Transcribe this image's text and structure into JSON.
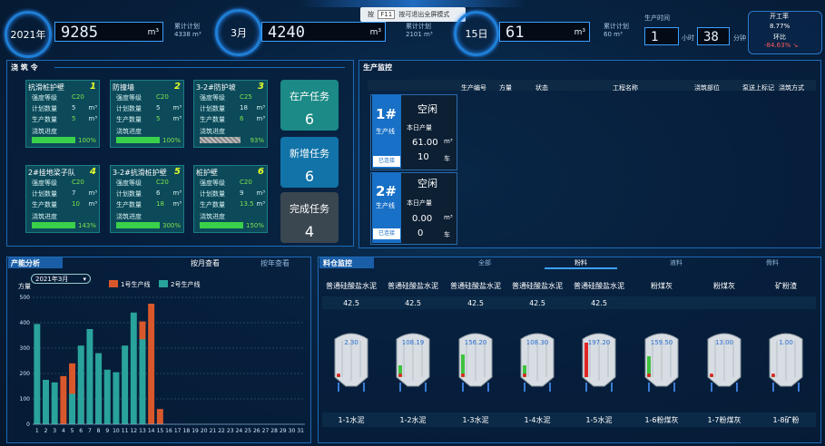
{
  "header": {
    "mode_key": "F11",
    "mode_label": "按可退出全屏模式",
    "mode_prefix": "按"
  },
  "stats": {
    "year": {
      "label": "2021年",
      "value": "9285",
      "unit": "m³",
      "plan_label": "累计计划",
      "plan_value": "4338 m³"
    },
    "month": {
      "label": "3月",
      "value": "4240",
      "unit": "m³",
      "plan_label": "累计计划",
      "plan_value": "2101 m³"
    },
    "day": {
      "label": "15日",
      "value": "61",
      "unit": "m³",
      "plan_label": "累计计划",
      "plan_value": "60 m³"
    },
    "production_time": {
      "label": "生产时间",
      "hours": "1",
      "hours_unit": "小时",
      "minutes": "38",
      "minutes_unit": "分钟"
    },
    "operation_rate": {
      "label": "开工率",
      "value": "8.77%",
      "compare_label": "环比",
      "compare_value": "-84.63% ↘"
    }
  },
  "pour_orders": {
    "title": "浇 筑 令",
    "cards": [
      {
        "name": "抗滑桩护壁",
        "num": "1",
        "grade_label": "强度等级",
        "grade": "C20",
        "plan_label": "计划数量",
        "plan": "5",
        "plan_unit": "m³",
        "prod_label": "生产数量",
        "prod": "5",
        "prod_unit": "m³",
        "progress_label": "浇筑进度",
        "progress": "100%",
        "progress_value": 1.0
      },
      {
        "name": "防撞墙",
        "num": "2",
        "grade_label": "强度等级",
        "grade": "C20",
        "plan_label": "计划数量",
        "plan": "5",
        "plan_unit": "m³",
        "prod_label": "生产数量",
        "prod": "5",
        "prod_unit": "m³",
        "progress_label": "浇筑进度",
        "progress": "100%",
        "progress_value": 1.0
      },
      {
        "name": "3-2#防护坡",
        "num": "3",
        "grade_label": "强度等级",
        "grade": "C25",
        "plan_label": "计划数量",
        "plan": "18",
        "plan_unit": "m³",
        "prod_label": "生产数量",
        "prod": "6",
        "prod_unit": "m³",
        "progress_label": "浇筑进度",
        "progress": "93%",
        "progress_value": 0.93
      },
      {
        "name": "2#挂地梁子队",
        "num": "4",
        "grade_label": "强度等级",
        "grade": "C20",
        "plan_label": "计划数量",
        "plan": "7",
        "plan_unit": "m³",
        "prod_label": "生产数量",
        "prod": "10",
        "prod_unit": "m³",
        "progress_label": "浇筑进度",
        "progress": "143%",
        "progress_value": 1.0
      },
      {
        "name": "3-2#抗滑桩护壁",
        "num": "5",
        "grade_label": "强度等级",
        "grade": "C20",
        "plan_label": "计划数量",
        "plan": "6",
        "plan_unit": "m³",
        "prod_label": "生产数量",
        "prod": "18",
        "prod_unit": "m³",
        "progress_label": "浇筑进度",
        "progress": "300%",
        "progress_value": 1.0
      },
      {
        "name": "桩护壁",
        "num": "6",
        "grade_label": "强度等级",
        "grade": "C20",
        "plan_label": "计划数量",
        "plan": "9",
        "plan_unit": "m³",
        "prod_label": "生产数量",
        "prod": "13.5",
        "prod_unit": "m³",
        "progress_label": "浇筑进度",
        "progress": "150%",
        "progress_value": 1.0
      }
    ],
    "tasks": [
      {
        "label": "在产任务",
        "value": "6"
      },
      {
        "label": "新增任务",
        "value": "6"
      },
      {
        "label": "完成任务",
        "value": "4"
      }
    ]
  },
  "production_monitor": {
    "title": "生产监控",
    "columns": [
      "生产编号",
      "方量",
      "状态",
      "工程名称",
      "浇筑部位",
      "泵送上标记",
      "浇筑方式"
    ],
    "lines": [
      {
        "id": "1#",
        "line_label": "生产线",
        "status": "空闲",
        "connected": "已连接",
        "today_label": "本日产量",
        "volume": "61.00",
        "volume_unit": "m³",
        "trucks": "10",
        "trucks_unit": "车"
      },
      {
        "id": "2#",
        "line_label": "生产线",
        "status": "空闲",
        "connected": "已连接",
        "today_label": "本日产量",
        "volume": "0.00",
        "volume_unit": "m³",
        "trucks": "0",
        "trucks_unit": "车"
      }
    ]
  },
  "output_analysis": {
    "title": "产能分析",
    "tabs": [
      "按月查看",
      "按年查看"
    ],
    "month_select": "2021年3月",
    "chart_data": {
      "type": "bar",
      "ylabel": "方量",
      "ylim": [
        0,
        500
      ],
      "yticks": [
        0,
        100,
        200,
        300,
        400,
        500
      ],
      "categories": [
        "1",
        "2",
        "3",
        "4",
        "5",
        "6",
        "7",
        "8",
        "9",
        "10",
        "11",
        "12",
        "13",
        "14",
        "15",
        "16",
        "17",
        "18",
        "19",
        "20",
        "21",
        "22",
        "23",
        "24",
        "25",
        "26",
        "27",
        "28",
        "29",
        "30",
        "31"
      ],
      "series": [
        {
          "name": "1号生产线",
          "color": "#d9582b",
          "values": [
            10,
            0,
            0,
            190,
            240,
            145,
            0,
            100,
            0,
            0,
            0,
            0,
            405,
            475,
            60,
            0,
            0,
            0,
            0,
            0,
            0,
            0,
            0,
            0,
            0,
            0,
            0,
            0,
            0,
            0,
            0
          ]
        },
        {
          "name": "2号生产线",
          "color": "#29a39c",
          "values": [
            395,
            175,
            165,
            0,
            120,
            310,
            375,
            280,
            215,
            205,
            310,
            440,
            335,
            0,
            0,
            0,
            0,
            0,
            0,
            0,
            0,
            0,
            0,
            0,
            0,
            0,
            0,
            0,
            0,
            0,
            0
          ]
        }
      ]
    }
  },
  "material_monitor": {
    "title": "料仓监控",
    "tabs": [
      "全部",
      "粉料",
      "液料",
      "骨料"
    ],
    "tanks": [
      {
        "name": "普通硅酸盐水泥",
        "grade": "42.5",
        "value": "2.30",
        "fill": 0.02,
        "bin": "1-1水泥"
      },
      {
        "name": "普通硅酸盐水泥",
        "grade": "42.5",
        "value": "108.19",
        "fill": 0.3,
        "bin": "1-2水泥"
      },
      {
        "name": "普通硅酸盐水泥",
        "grade": "42.5",
        "value": "156.20",
        "fill": 0.6,
        "bin": "1-3水泥"
      },
      {
        "name": "普通硅酸盐水泥",
        "grade": "42.5",
        "value": "108.30",
        "fill": 0.3,
        "bin": "1-4水泥"
      },
      {
        "name": "普通硅酸盐水泥",
        "grade": "42.5",
        "value": "197.20",
        "fill": 0.9,
        "bin": "1-5水泥",
        "red": true
      },
      {
        "name": "粉煤灰",
        "grade": "",
        "value": "159.50",
        "fill": 0.55,
        "bin": "1-6粉煤灰"
      },
      {
        "name": "粉煤灰",
        "grade": "",
        "value": "13.00",
        "fill": 0.05,
        "bin": "1-7粉煤灰"
      },
      {
        "name": "矿粉渣",
        "grade": "",
        "value": "1.00",
        "fill": 0.02,
        "bin": "1-8矿粉"
      }
    ]
  }
}
